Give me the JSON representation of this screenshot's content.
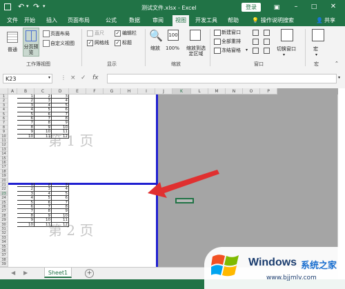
{
  "titlebar": {
    "filename": "测试文件.xlsx",
    "separator": "-",
    "app": "Excel",
    "login": "登录",
    "undo_icon": "undo-icon",
    "redo_icon": "redo-icon",
    "save_icon": "save-icon"
  },
  "menu": {
    "tabs": [
      "文件",
      "开始",
      "插入",
      "页面布局",
      "公式",
      "数据",
      "审阅",
      "视图",
      "开发工具",
      "帮助"
    ],
    "active": "视图",
    "search": "操作说明搜索",
    "share": "共享"
  },
  "ribbon": {
    "workbook_views": {
      "normal": "普通",
      "page_break": "分页预览",
      "page_layout": "页面布局",
      "custom": "自定义视图",
      "group": "工作簿视图"
    },
    "show": {
      "ruler": "直尺",
      "formula_bar": "编辑栏",
      "gridlines": "网格线",
      "headings": "标题",
      "group": "显示"
    },
    "zoom": {
      "zoom": "缩放",
      "pct": "100%",
      "to_selection": "缩放到选定区域",
      "group": "缩放"
    },
    "window": {
      "new": "新建窗口",
      "arrange": "全部重排",
      "freeze": "冻结窗格",
      "switch": "切换窗口",
      "group": "窗口"
    },
    "macro": {
      "macros": "宏",
      "group": "宏"
    }
  },
  "formula": {
    "cell_ref": "K23",
    "cancel": "×",
    "enter": "✓",
    "fx": "fx",
    "content": ""
  },
  "sheet": {
    "columns": [
      "A",
      "B",
      "C",
      "D",
      "E",
      "F",
      "G",
      "H",
      "I",
      "J",
      "K",
      "L",
      "M",
      "N",
      "O",
      "P"
    ],
    "rows": [
      "1",
      "2",
      "3",
      "4",
      "5",
      "6",
      "7",
      "8",
      "9",
      "10",
      "11",
      "12",
      "13",
      "14",
      "15",
      "16",
      "17",
      "18",
      "19",
      "20",
      "21",
      "22",
      "23",
      "24",
      "25",
      "26",
      "27",
      "28",
      "29",
      "30",
      "31",
      "32",
      "33",
      "34",
      "35",
      "36",
      "37",
      "38",
      "39"
    ],
    "page1_label": "第 1 页",
    "page2_label": "第 2 页",
    "block": [
      [
        "1",
        "2",
        "3"
      ],
      [
        "2",
        "3",
        "4"
      ],
      [
        "3",
        "4",
        "5"
      ],
      [
        "4",
        "5",
        "6"
      ],
      [
        "5",
        "6",
        "7"
      ],
      [
        "6",
        "7",
        "8"
      ],
      [
        "7",
        "8",
        "9"
      ],
      [
        "8",
        "9",
        "10"
      ],
      [
        "9",
        "10",
        "11"
      ],
      [
        "10",
        "11",
        "12"
      ]
    ]
  },
  "sheet_tabs": {
    "name": "Sheet1",
    "add": "+"
  },
  "watermark": {
    "brand": "Windows",
    "cn": "系统之家",
    "url": "www.bjjmlv.com"
  },
  "colors": {
    "excel_green": "#217346",
    "page_break_blue": "#1f1fd0",
    "arrow_red": "#e03030"
  }
}
